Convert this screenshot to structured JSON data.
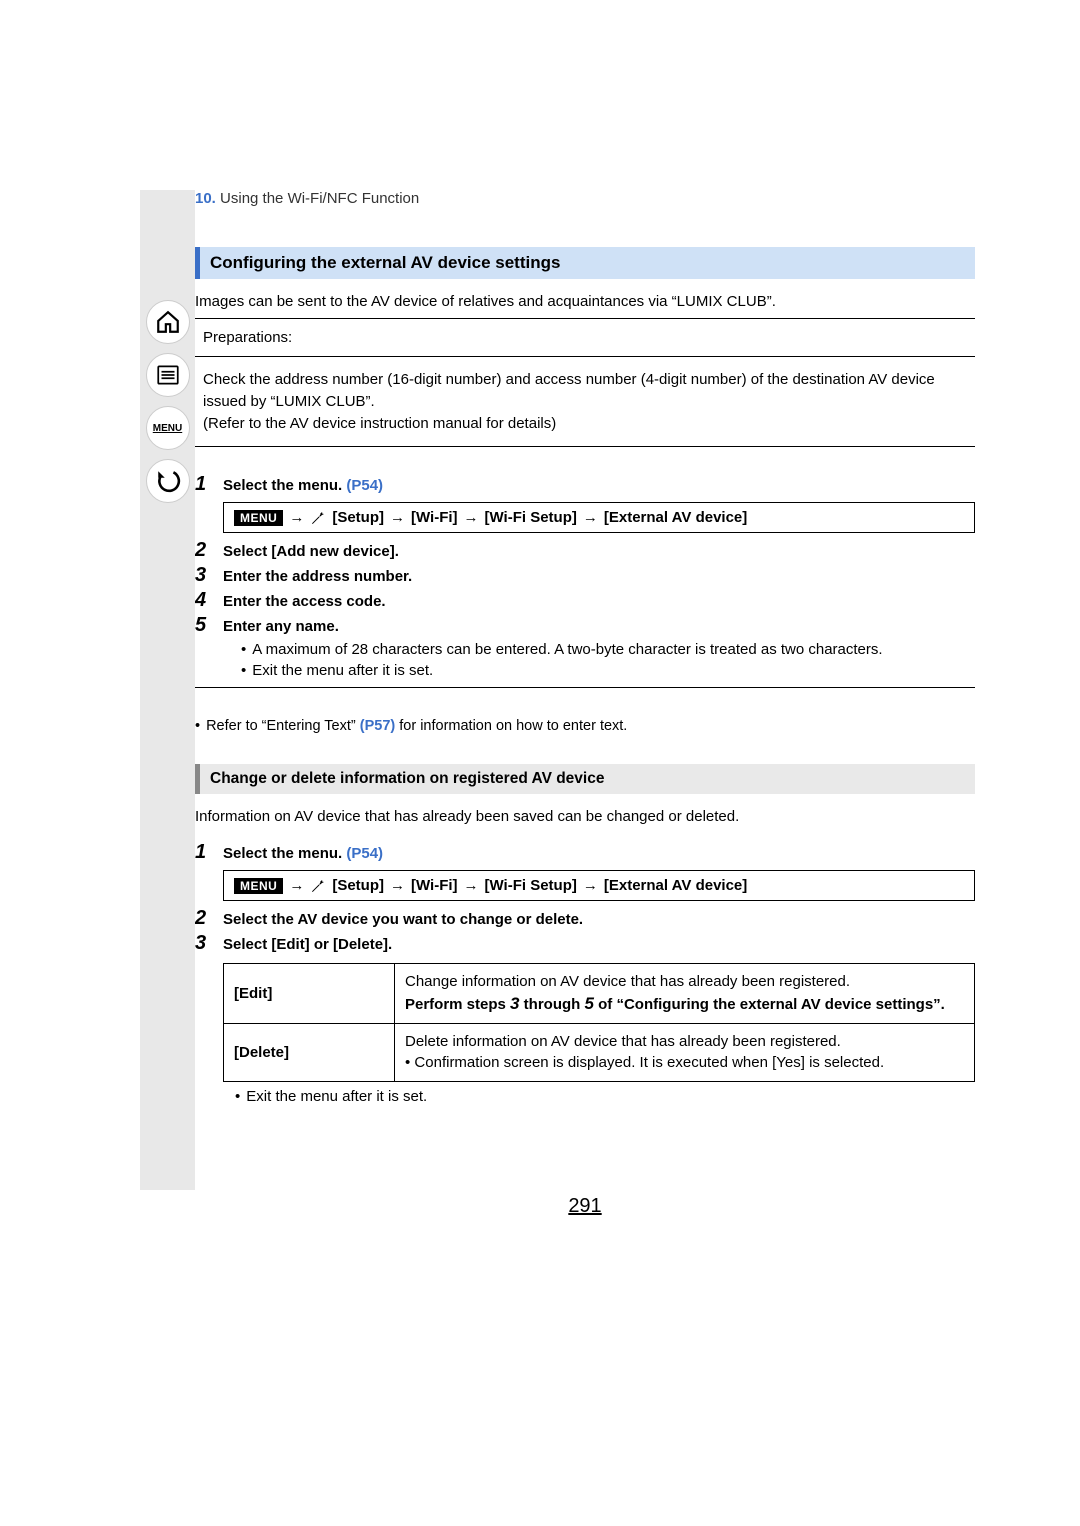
{
  "breadcrumb": {
    "num": "10.",
    "text": "Using the Wi-Fi/NFC Function"
  },
  "nav": {
    "menu_label": "MENU"
  },
  "heading1": "Configuring the external AV device settings",
  "intro": "Images can be sent to the AV device of relatives and acquaintances via “LUMIX CLUB”.",
  "prep": {
    "title": "Preparations:",
    "line1": "Check the address number (16-digit number) and access number (4-digit number) of the destination AV device issued by “LUMIX CLUB”.",
    "line2": "(Refer to the AV device instruction manual for details)"
  },
  "sectionA": {
    "s1_num": "1",
    "s1_text": "Select the menu. ",
    "s1_link": "(P54)",
    "menu_badge": "MENU",
    "path": {
      "p1": "[Setup]",
      "p2": "[Wi-Fi]",
      "p3": "[Wi-Fi Setup]",
      "p4": "[External AV device]"
    },
    "s2_num": "2",
    "s2_text": "Select [Add new device].",
    "s3_num": "3",
    "s3_text": "Enter the address number.",
    "s4_num": "4",
    "s4_text": "Enter the access code.",
    "s5_num": "5",
    "s5_text": "Enter any name.",
    "bullet1": "A maximum of 28 characters can be entered. A two-byte character is treated as two characters.",
    "bullet2": "Exit the menu after it is set."
  },
  "note": {
    "pre": "Refer to “Entering Text” ",
    "link": "(P57)",
    "post": " for information on how to enter text."
  },
  "heading2": "Change or delete information on registered AV device",
  "intro2": "Information on AV device that has already been saved can be changed or deleted.",
  "sectionB": {
    "s1_num": "1",
    "s1_text": "Select the menu. ",
    "s1_link": "(P54)",
    "s2_num": "2",
    "s2_text": "Select the AV device you want to change or delete.",
    "s3_num": "3",
    "s3_text": "Select [Edit] or [Delete]."
  },
  "table": {
    "edit_label": "[Edit]",
    "edit_l1": "Change information on AV device that has already been registered.",
    "edit_l2a": "Perform steps ",
    "edit_l2b": "3",
    "edit_l2c": " through ",
    "edit_l2d": "5",
    "edit_l2e": " of “Configuring the external AV device settings”.",
    "del_label": "[Delete]",
    "del_l1": "Delete information on AV device that has already been registered.",
    "del_l2": "Confirmation screen is displayed. It is executed when [Yes] is selected."
  },
  "exit_note": "Exit the menu after it is set.",
  "page_number": "291"
}
